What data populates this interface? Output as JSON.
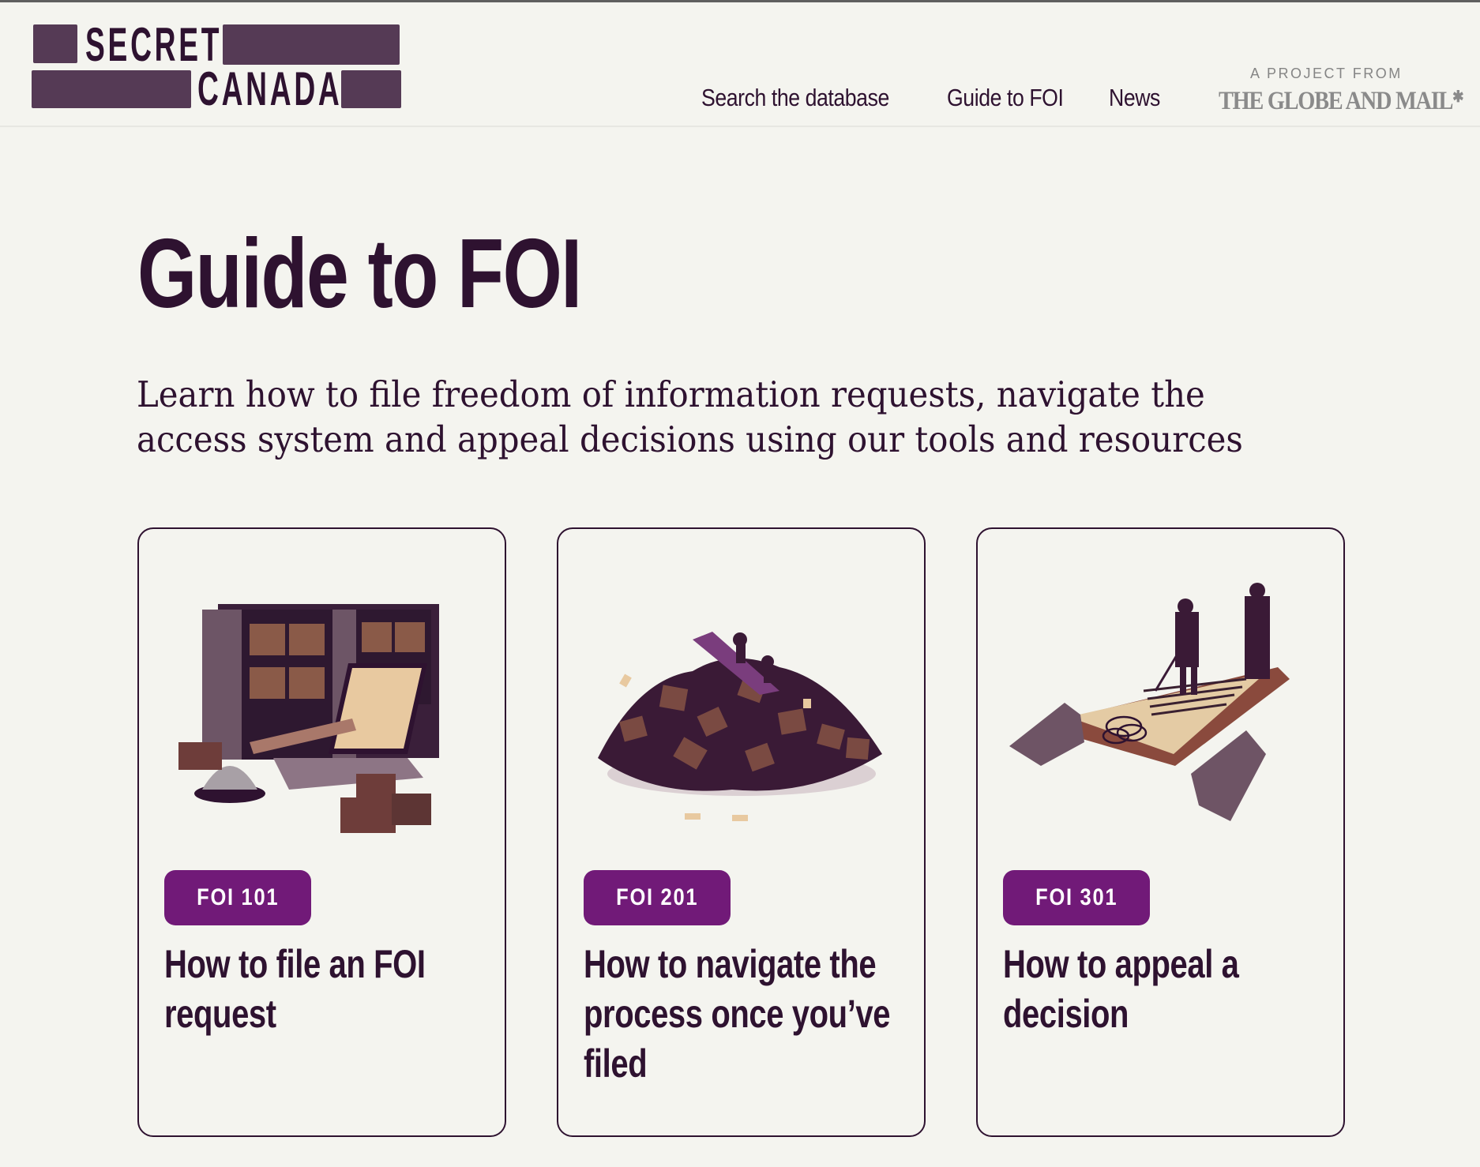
{
  "header": {
    "logo": {
      "line1": "SECRET",
      "line2": "CANADA"
    },
    "nav": [
      {
        "label": "Search the database"
      },
      {
        "label": "Guide to FOI"
      },
      {
        "label": "News"
      }
    ],
    "project": {
      "eyebrow": "A PROJECT FROM",
      "brand": "THE GLOBE AND MAIL",
      "brand_mark": "maple-leaf-icon"
    }
  },
  "main": {
    "title": "Guide to FOI",
    "intro_line1": "Learn how to file freedom of information requests, navigate the",
    "intro_line2": "access system and appeal decisions using our tools and resources",
    "cards": [
      {
        "badge": "FOI 101",
        "heading": "How to file an FOI request",
        "illustration": "filing-cabinet-laptop-illustration"
      },
      {
        "badge": "FOI 201",
        "heading": "How to navigate the process once you’ve filed",
        "illustration": "boat-on-box-pile-illustration"
      },
      {
        "badge": "FOI 301",
        "heading": "How to appeal a decision",
        "illustration": "hands-holding-document-illustration"
      }
    ]
  },
  "colors": {
    "background": "#f4f4ef",
    "text": "#2e1230",
    "logo_bar": "#553a55",
    "badge": "#711a78",
    "brand_gray": "#8a8a8a"
  }
}
